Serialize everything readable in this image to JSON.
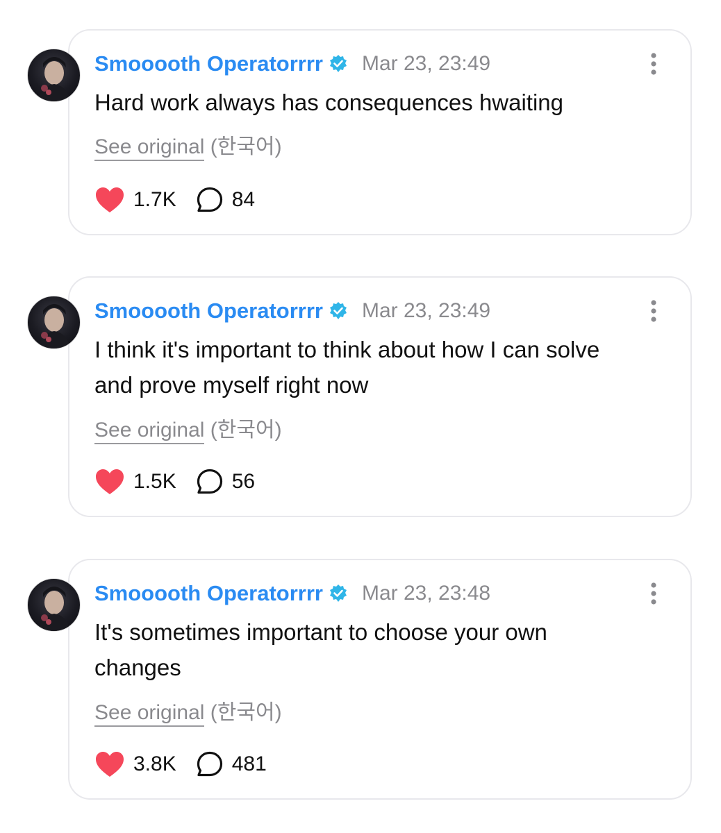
{
  "posts": [
    {
      "username": "Smooooth Operatorrrr",
      "timestamp": "Mar 23, 23:49",
      "text": "Hard work always has consequences hwaiting",
      "see_original": "See original",
      "language": "(한국어)",
      "likes": "1.7K",
      "comments": "84"
    },
    {
      "username": "Smooooth Operatorrrr",
      "timestamp": "Mar 23, 23:49",
      "text": "I think it's important to think about how I can solve and prove myself right now",
      "see_original": "See original",
      "language": "(한국어)",
      "likes": "1.5K",
      "comments": "56"
    },
    {
      "username": "Smooooth Operatorrrr",
      "timestamp": "Mar 23, 23:48",
      "text": "It's sometimes important to choose your own changes",
      "see_original": "See original",
      "language": "(한국어)",
      "likes": "3.8K",
      "comments": "481"
    }
  ],
  "colors": {
    "username": "#2a8bf2",
    "verified_badge": "#2fb5e8",
    "heart": "#f5475a",
    "meta_text": "#8a8a8e",
    "card_border": "#e8e8ec"
  },
  "icons": {
    "verified": "verified-badge-icon",
    "more": "vertical-ellipsis-icon",
    "like": "heart-icon",
    "comment": "speech-bubble-icon"
  }
}
